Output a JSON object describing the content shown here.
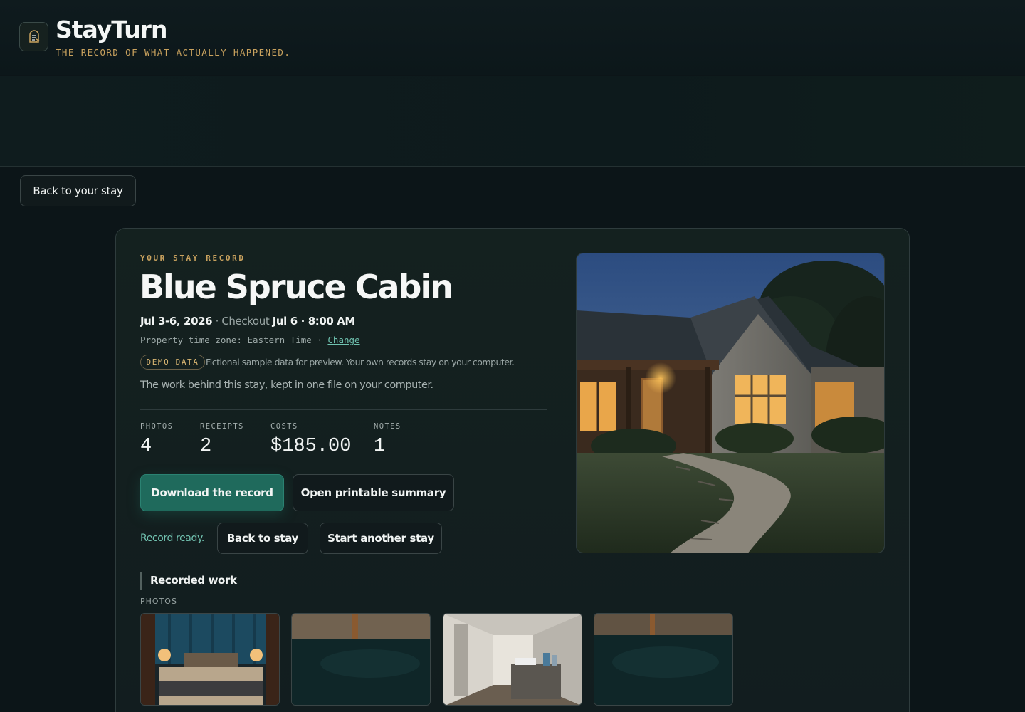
{
  "app": {
    "name": "StayTurn",
    "tagline": "THE RECORD OF WHAT ACTUALLY HAPPENED."
  },
  "nav": {
    "back_label": "Back to your stay"
  },
  "record": {
    "eyebrow": "YOUR STAY RECORD",
    "title": "Blue Spruce Cabin",
    "dates": "Jul 3-6, 2026",
    "checkout_label": "Checkout",
    "checkout_value": "Jul 6 · 8:00 AM",
    "timezone_text": "Property time zone: Eastern Time ·",
    "timezone_change": "Change",
    "demo_badge": "DEMO DATA",
    "demo_note": "Fictional sample data for preview. Your own records stay on your computer.",
    "description": "The work behind this stay, kept in one file on your computer."
  },
  "stats": [
    {
      "label": "PHOTOS",
      "value": "4"
    },
    {
      "label": "RECEIPTS",
      "value": "2"
    },
    {
      "label": "COSTS",
      "value": "$185.00"
    },
    {
      "label": "NOTES",
      "value": "1"
    }
  ],
  "actions": {
    "download": "Download the record",
    "printable": "Open printable summary",
    "status": "Record ready.",
    "back_to_stay": "Back to stay",
    "start_another": "Start another stay"
  },
  "recorded_work": {
    "title": "Recorded work",
    "photos_label": "PHOTOS",
    "photos": [
      {
        "subject": "bedroom"
      },
      {
        "subject": "floor"
      },
      {
        "subject": "hallway"
      },
      {
        "subject": "floor"
      }
    ]
  },
  "colors": {
    "accent": "#1f6a5c",
    "gold": "#c9a25e",
    "teal_text": "#72c3b1"
  }
}
